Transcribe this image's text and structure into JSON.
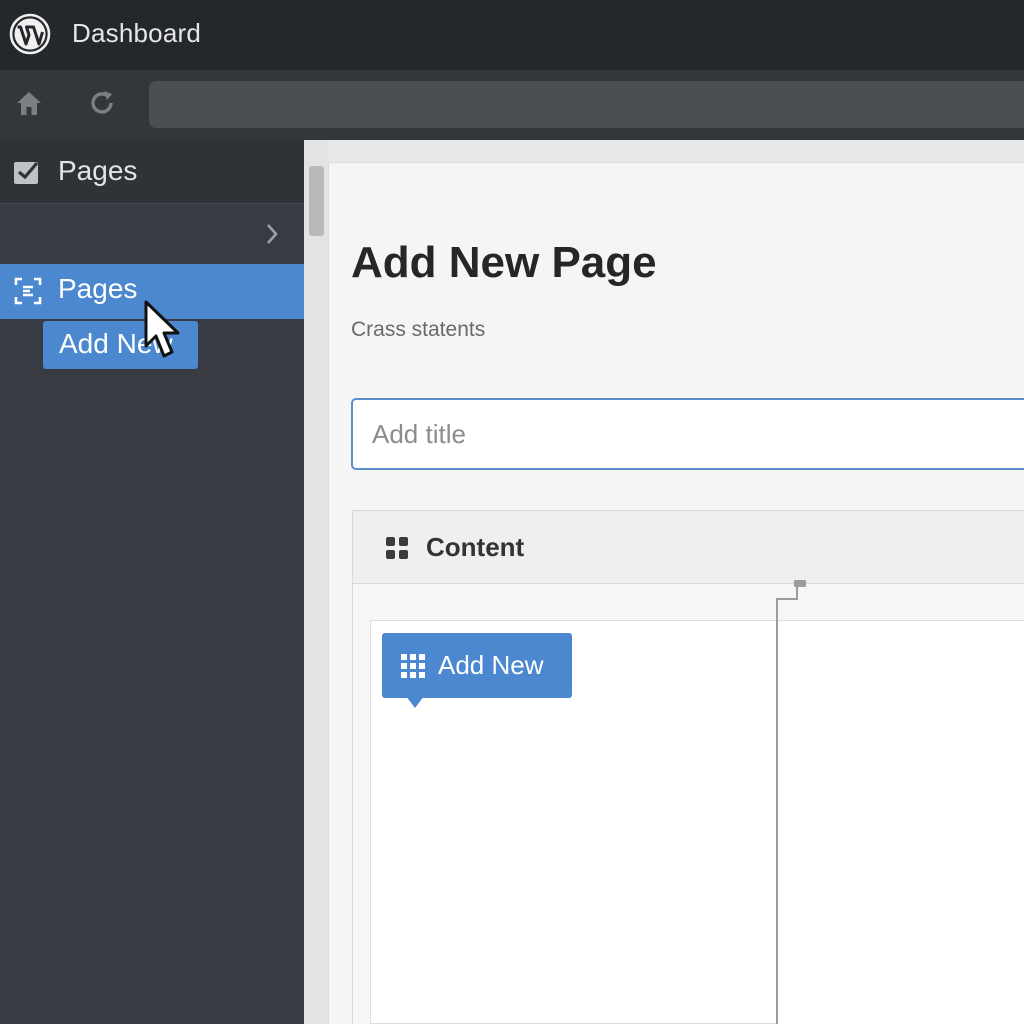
{
  "topbar": {
    "title": "Dashboard",
    "logo": "wordpress-logo"
  },
  "toolbar": {
    "home_icon": "home-icon",
    "reload_icon": "reload-icon",
    "address": ""
  },
  "sidebar": {
    "header_label": "Pages",
    "header_icon": "checkbox-icon",
    "active_item": {
      "label": "Pages",
      "icon": "pages-icon"
    },
    "submenu_item": {
      "label": "Add New"
    }
  },
  "main": {
    "page_title": "Add New Page",
    "subtitle": "Crass statents",
    "title_input": {
      "value": "",
      "placeholder": "Add title"
    },
    "content_section": {
      "label": "Content",
      "icon": "blocks-icon"
    },
    "add_new_button": {
      "label": "Add New",
      "icon": "grid-icon"
    }
  },
  "colors": {
    "accent": "#4c88cf",
    "topbar": "#24272b",
    "sidebar": "#383c42",
    "panel": "#f5f5f5"
  }
}
